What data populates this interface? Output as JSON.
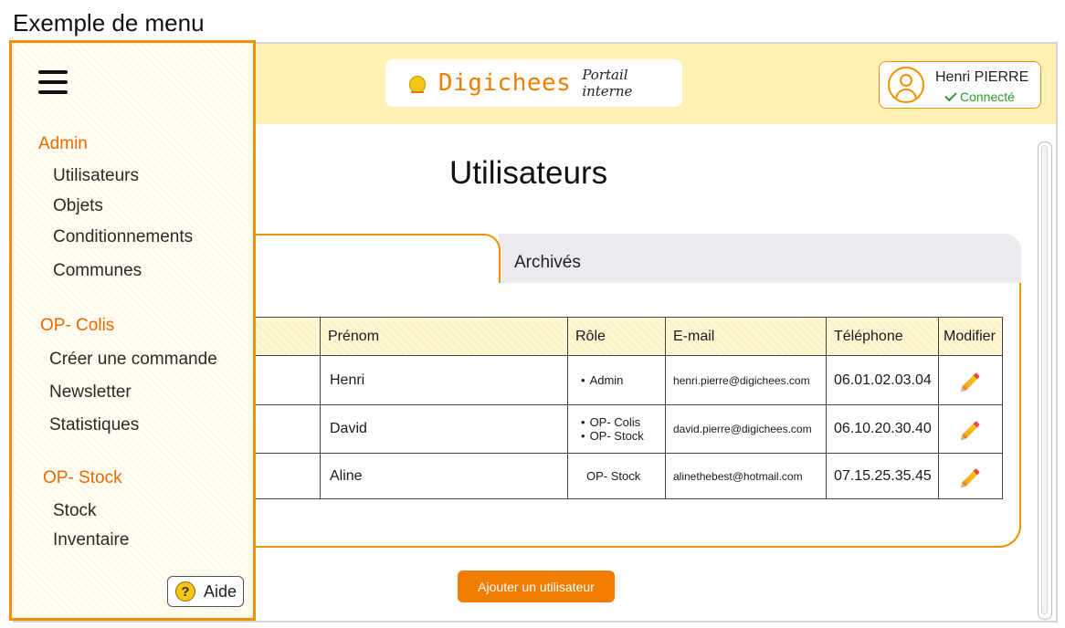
{
  "caption": "Exemple de menu",
  "header": {
    "brand": "Digichees",
    "brand_sub": "Portail interne",
    "user_name": "Henri PIERRE",
    "user_status": "Connecté"
  },
  "page_title": "Utilisateurs",
  "tabs": {
    "archived": "Archivés"
  },
  "table": {
    "headers": {
      "prenom": "Prénom",
      "role": "Rôle",
      "email": "E-mail",
      "telephone": "Téléphone",
      "modifier": "Modifier"
    },
    "rows": [
      {
        "prenom": "Henri",
        "roles": [
          "Admin"
        ],
        "email": "henri.pierre@digichees.com",
        "telephone": "06.01.02.03.04"
      },
      {
        "prenom": "David",
        "roles": [
          "OP- Colis",
          "OP- Stock"
        ],
        "email": "david.pierre@digichees.com",
        "telephone": "06.10.20.30.40"
      },
      {
        "prenom": "Aline",
        "role_plain": "OP- Stock",
        "email": "alinethebest@hotmail.com",
        "telephone": "07.15.25.35.45"
      }
    ]
  },
  "add_button": "Ajouter un utilisateur",
  "sidebar": {
    "sections": [
      {
        "title": "Admin",
        "items": [
          "Utilisateurs",
          "Objets",
          "Conditionnements",
          "Communes"
        ]
      },
      {
        "title": "OP- Colis",
        "items": [
          "Créer une commande",
          "Newsletter",
          "Statistiques"
        ]
      },
      {
        "title": "OP- Stock",
        "items": [
          "Stock",
          "Inventaire"
        ]
      }
    ],
    "help": "Aide"
  },
  "colors": {
    "accent": "#f29100",
    "header_bg": "#fff0b3",
    "button": "#f07d00",
    "status": "#2e9a2e"
  }
}
